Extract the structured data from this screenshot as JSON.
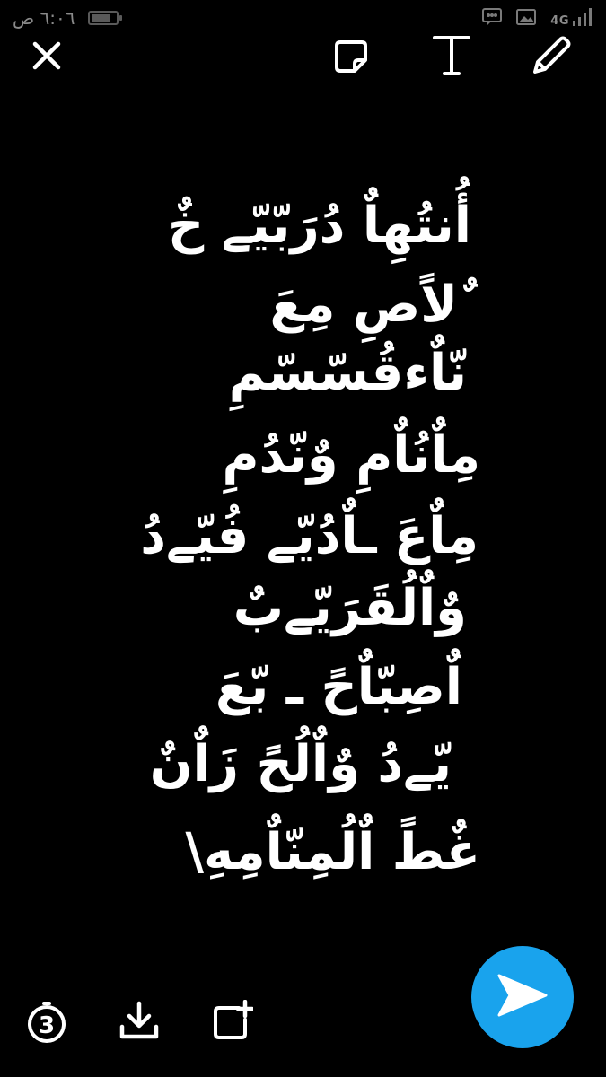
{
  "status_bar": {
    "time": "٦:٠٦ ص",
    "network_type": "4G",
    "battery_level": 0.82
  },
  "caption": {
    "lines": [
      "أُنتُهِاٌ دُرَبّيّے خٌ",
      "ٌلاًصِ مِعَ",
      "نّاٌءقُسّسّمِ",
      "مِاٌنُاٌمِ وٌنّدُمِ",
      "مِاٌعَ ـاٌدُيّے فُيّےدُ",
      "وٌاٌلُقَرَيّےبٌ",
      "اٌصِبّاٌحً ـ بّعَ",
      "يّےدُ وٌاٌلُحً زَاٌنٌ",
      "غٌطً اٌلُمِنّاٌمِهِ\\"
    ]
  },
  "icons": {
    "close": "close-icon",
    "sticker": "sticker-icon",
    "text": "text-icon",
    "draw": "pencil-icon",
    "timer": "timer-icon",
    "download": "download-icon",
    "add_story": "add-to-story-icon",
    "send": "send-arrow-icon"
  },
  "timer": {
    "seconds": "3"
  },
  "colors": {
    "background": "#000000",
    "foreground": "#ffffff",
    "send_button": "#19a3ed",
    "status_icons": "#7a7a7a"
  }
}
